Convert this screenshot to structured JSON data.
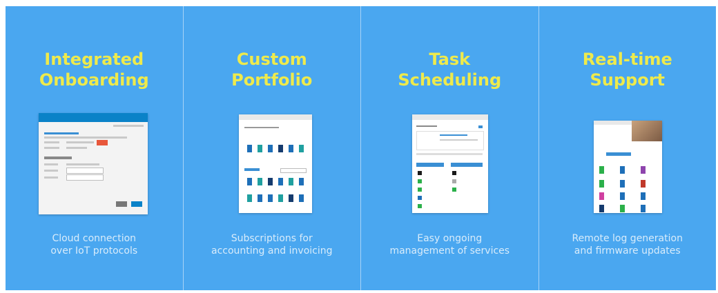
{
  "features": [
    {
      "title": [
        "Integrated",
        "Onboarding"
      ],
      "desc": [
        "Cloud connection",
        "over IoT protocols"
      ]
    },
    {
      "title": [
        "Custom",
        "Portfolio"
      ],
      "desc": [
        "Subscriptions for",
        "accounting and invoicing"
      ]
    },
    {
      "title": [
        "Task",
        "Scheduling"
      ],
      "desc": [
        "Easy ongoing",
        "management of services"
      ]
    },
    {
      "title": [
        "Real-time",
        "Support"
      ],
      "desc": [
        "Remote log generation",
        "and firmware updates"
      ]
    }
  ],
  "colors": {
    "background": "#4aa7f0",
    "title": "#eeea4c",
    "desc": "#d8ecfb",
    "divider": "#a8d3f7"
  }
}
